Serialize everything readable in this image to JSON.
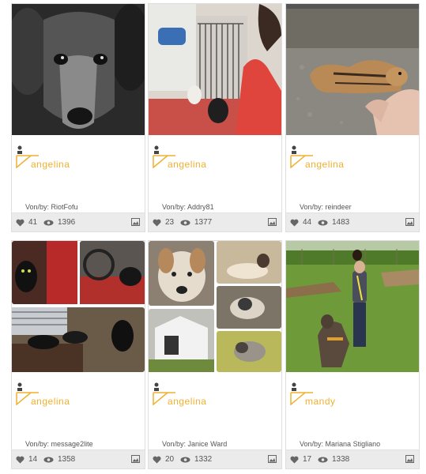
{
  "labels": {
    "author_prefix": "Von/by:"
  },
  "colors": {
    "accent": "#f0b030",
    "stats_bg": "#ebebeb",
    "card_border": "#dedede"
  },
  "cards": [
    {
      "username": "angelina",
      "author": "RiotFofu",
      "likes": "41",
      "views": "1396",
      "photo": "grey dog close-up portrait"
    },
    {
      "username": "angelina",
      "author": "Addry81",
      "likes": "23",
      "views": "1377",
      "photo": "two dogs by a gate with a girl in red"
    },
    {
      "username": "angelina",
      "author": "reindeer",
      "likes": "44",
      "views": "1483",
      "photo": "chipmunk on a hand"
    },
    {
      "username": "angelina",
      "author": "message2lite",
      "likes": "14",
      "views": "1358",
      "photo": "collage of black cats"
    },
    {
      "username": "angelina",
      "author": "Janice Ward",
      "likes": "20",
      "views": "1332",
      "photo": "collage of a dog and cats"
    },
    {
      "username": "mandy",
      "author": "Mariana Stigliano",
      "likes": "17",
      "views": "1338",
      "photo": "woman with a dog on a lawn"
    }
  ]
}
